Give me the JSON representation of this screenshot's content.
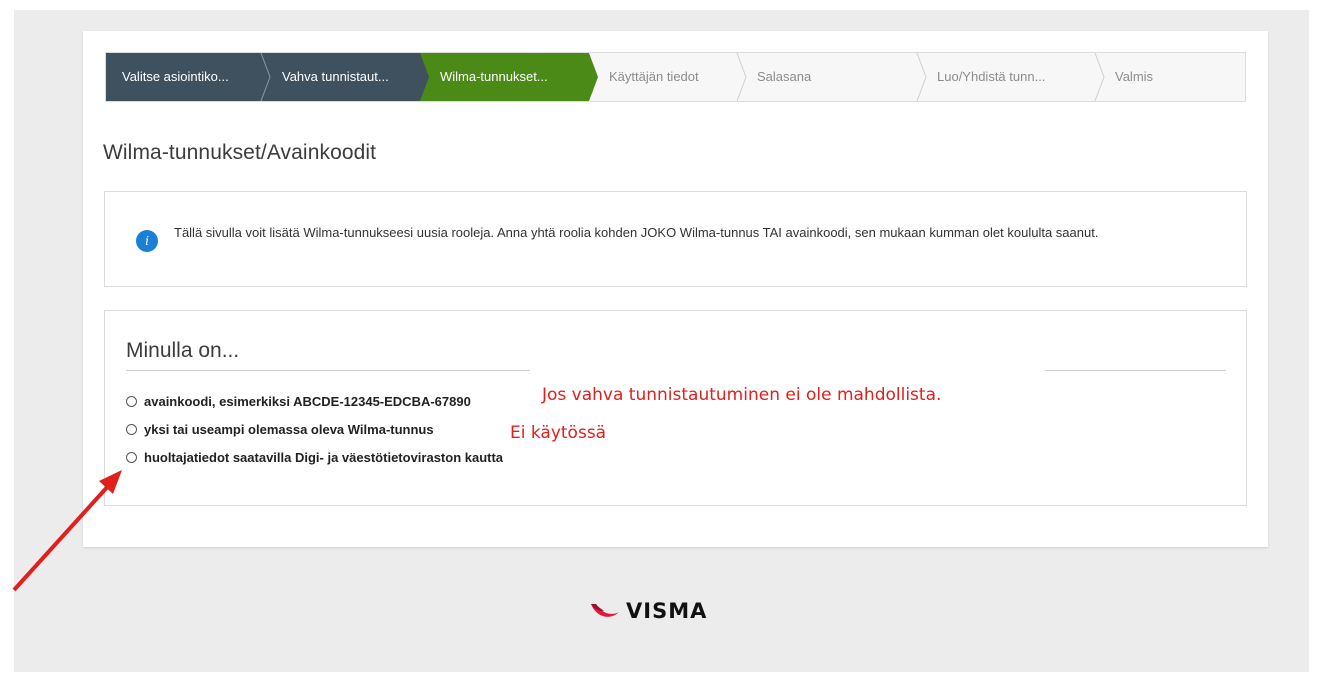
{
  "top_text": "",
  "stepper": {
    "steps": [
      {
        "label": "Valitse asiointiko...",
        "state": "done"
      },
      {
        "label": "Vahva tunnistaut...",
        "state": "done"
      },
      {
        "label": "Wilma-tunnukset...",
        "state": "active"
      },
      {
        "label": "Käyttäjän tiedot",
        "state": "todo"
      },
      {
        "label": "Salasana",
        "state": "todo"
      },
      {
        "label": "Luo/Yhdistä tunn...",
        "state": "todo"
      },
      {
        "label": "Valmis",
        "state": "todo"
      }
    ]
  },
  "page_title": "Wilma-tunnukset/Avainkoodit",
  "info": {
    "icon": "info-icon",
    "text": "Tällä sivulla voit lisätä Wilma-tunnukseesi uusia rooleja. Anna yhtä roolia kohden JOKO Wilma-tunnus TAI avainkoodi, sen mukaan kumman olet koululta saanut."
  },
  "choices": {
    "title": "Minulla on...",
    "options": [
      {
        "label": "avainkoodi, esimerkiksi ABCDE-12345-EDCBA-67890",
        "note": "Jos vahva tunnistautuminen ei ole mahdollista."
      },
      {
        "label": "yksi tai useampi olemassa oleva Wilma-tunnus",
        "note": "Ei käytössä"
      },
      {
        "label": "huoltajatiedot saatavilla Digi- ja väestötietoviraston kautta",
        "note": ""
      }
    ]
  },
  "footer": {
    "logo_text": "VISMA"
  },
  "colors": {
    "step_done": "#3f505e",
    "step_active": "#4b8a17",
    "info_icon": "#1c7fd6",
    "annotation_red": "#e0201c",
    "logo_red": "#e5173f"
  }
}
